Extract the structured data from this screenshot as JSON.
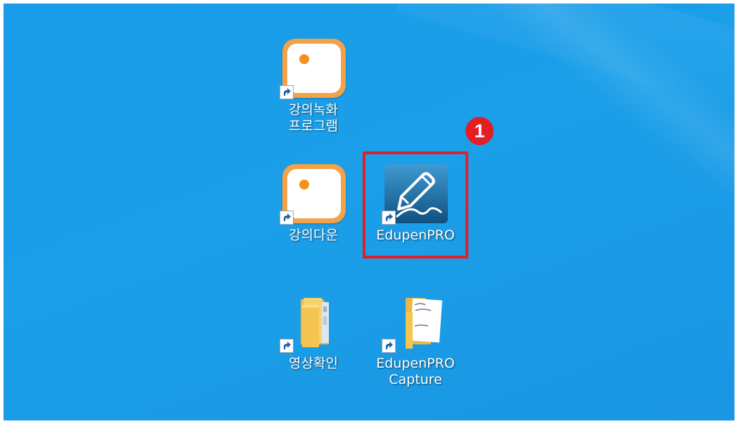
{
  "desktop": {
    "background_color": "#1a9ce8",
    "icons": [
      {
        "id": "lecture-record",
        "label": "강의녹화\n프로그램",
        "icon": "orange-rounded-square-icon",
        "shortcut": true
      },
      {
        "id": "lecture-download",
        "label": "강의다운",
        "icon": "orange-rounded-square-icon",
        "shortcut": true
      },
      {
        "id": "edupen-pro",
        "label": "EdupenPRO",
        "icon": "edupen-pen-icon",
        "shortcut": true
      },
      {
        "id": "video-check",
        "label": "영상확인",
        "icon": "folder-icon",
        "shortcut": true
      },
      {
        "id": "edupen-capture",
        "label": "EdupenPRO\nCapture",
        "icon": "folder-with-paper-icon",
        "shortcut": true
      }
    ]
  },
  "annotation": {
    "step_number": "1",
    "highlight_color": "#e31e24"
  }
}
